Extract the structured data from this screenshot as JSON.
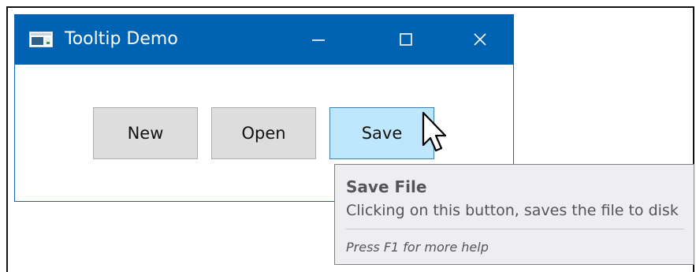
{
  "window": {
    "title": "Tooltip Demo",
    "app_icon": "window-app-icon",
    "controls": {
      "minimize_icon": "minimize-icon",
      "maximize_icon": "maximize-icon",
      "close_icon": "close-icon"
    }
  },
  "buttons": {
    "new_label": "New",
    "open_label": "Open",
    "save_label": "Save"
  },
  "tooltip": {
    "title": "Save File",
    "body": "Clicking on this button, saves the file to disk",
    "help": "Press F1 for more help"
  },
  "colors": {
    "titlebar": "#0063b1",
    "button_face": "#dddddd",
    "button_hover": "#bee6fd",
    "tooltip_bg": "#eeeef2"
  }
}
